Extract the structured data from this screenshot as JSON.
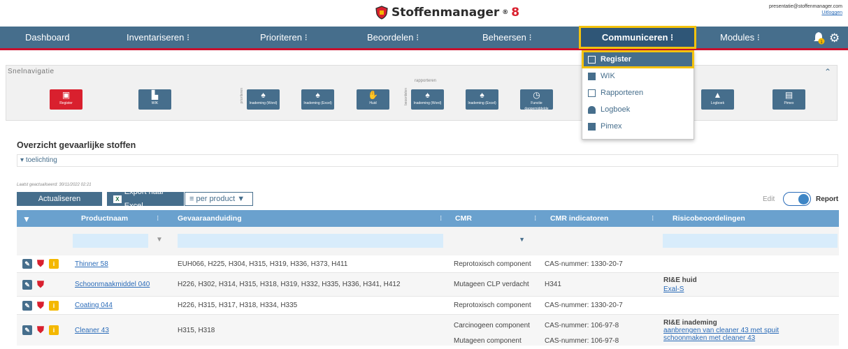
{
  "header": {
    "brand_name": "Stoffenmanager",
    "brand_version": "8",
    "user_email": "presentatie@stoffenmanager.com",
    "logout": "Uitloggen"
  },
  "nav": {
    "items": [
      "Dashboard",
      "Inventariseren ⁝",
      "Prioriteren ⁝",
      "Beoordelen ⁝",
      "Beheersen ⁝",
      "Communiceren ⁝",
      "Modules ⁝"
    ],
    "notification_count": "1"
  },
  "dropdown": {
    "items": [
      "Register",
      "WIK",
      "Rapporteren",
      "Logboek",
      "Pimex"
    ]
  },
  "snel": {
    "title": "Snelnavigatie",
    "group_prioriteren": "prioriteren",
    "group_rapporteren": "rapporteren",
    "group_beoordelen": "beoordelen",
    "tiles": [
      "Register",
      "WIK",
      "Inademing (Word)",
      "Inademing (Excel)",
      "Huid",
      "Inademing (Word)",
      "Inademing (Excel)",
      "Functie daggemiddelde",
      "Logboek",
      "Pimex"
    ]
  },
  "overview": {
    "title": "Overzicht gevaarlijke stoffen",
    "toelichting": "toelichting",
    "last_updated": "Laatst geactualiseerd: 30/11/2022 02:21",
    "btn_refresh": "Actualiseren",
    "btn_export": "Export naar Excel",
    "per_product": "per product",
    "edit": "Edit",
    "report": "Report"
  },
  "table": {
    "headers": [
      "Productnaam",
      "Gevaaraanduiding",
      "CMR",
      "CMR indicatoren",
      "Risicobeoordelingen"
    ],
    "rows": [
      {
        "product": "Thinner 58",
        "gevaar": "EUH066, H225, H304, H315, H319, H336, H373, H411",
        "cmr": "Reprotoxisch component",
        "ind": "CAS-nummer: 1330-20-7",
        "risk_title": "",
        "risk_link": ""
      },
      {
        "product": "Schoonmaakmiddel 040",
        "gevaar": "H226, H302, H314, H315, H318, H319, H332, H335, H336, H341, H412",
        "cmr": "Mutageen CLP verdacht",
        "ind": "H341",
        "risk_title": "RI&E huid",
        "risk_link": "Exal-S"
      },
      {
        "product": "Coating 044",
        "gevaar": "H226, H315, H317, H318, H334, H335",
        "cmr": "Reprotoxisch component",
        "ind": "CAS-nummer: 1330-20-7",
        "risk_title": "",
        "risk_link": ""
      },
      {
        "product": "Cleaner 43",
        "gevaar": "H315, H318",
        "cmr": "Carcinogeen component",
        "cmr2": "Mutageen component",
        "ind": "CAS-nummer: 106-97-8",
        "ind2": "CAS-nummer: 106-97-8",
        "risk_title": "RI&E inademing",
        "risk_link": "aanbrengen van cleaner 43 met spuit",
        "risk_link2": "schoonmaken met cleaner 43"
      }
    ]
  },
  "colors": {
    "nav": "#466e8c",
    "accent": "#d9202e",
    "highlight": "#f4c20d",
    "table_header": "#6aa1ce"
  }
}
